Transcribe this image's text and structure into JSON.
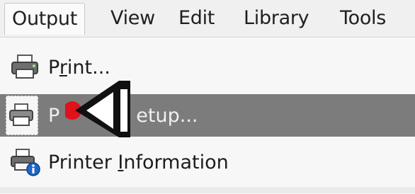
{
  "menubar": {
    "tabs": [
      {
        "label": "Output"
      },
      {
        "label": "View"
      },
      {
        "label": "Edit"
      },
      {
        "label": "Library"
      },
      {
        "label": "Tools"
      }
    ]
  },
  "dropdown": {
    "items": [
      {
        "label_prefix": "P",
        "label_underline": "r",
        "label_suffix": "int...",
        "icon": "printer-icon"
      },
      {
        "label_visible_start": "P",
        "label_visible_end": "etup...",
        "icon": "printer-setup-icon",
        "state": "highlighted"
      },
      {
        "label_prefix": "Printer ",
        "label_underline": "I",
        "label_suffix": "nformation",
        "icon": "printer-info-icon"
      }
    ]
  },
  "cursor": {
    "icon": "arrow-pointer-icon"
  },
  "colors": {
    "highlight": "#7c7c7c",
    "menubar_bg": "#f0f0f0",
    "cursor_dot": "#e0121b"
  }
}
